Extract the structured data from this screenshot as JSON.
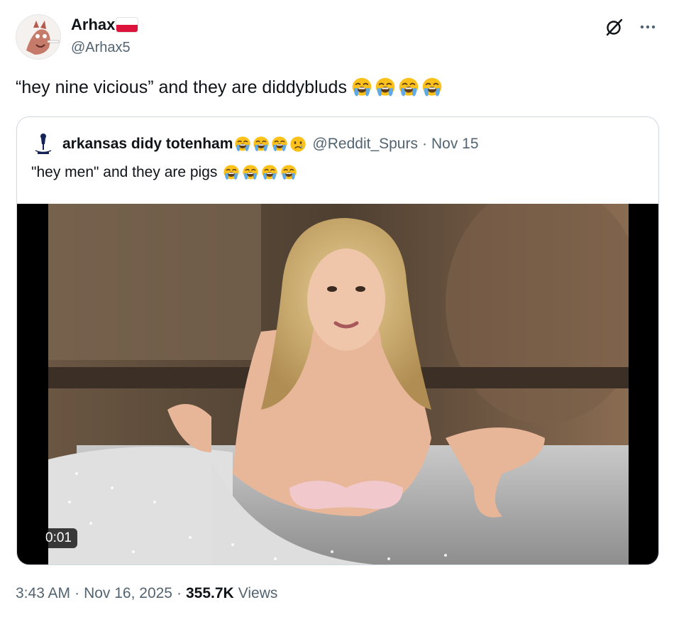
{
  "author": {
    "display_name": "Arhax",
    "handle": "@Arhax5",
    "flag_icon": "poland-flag-icon",
    "flag_colors": [
      "#ffffff",
      "#dc143c"
    ]
  },
  "tweet": {
    "text": "“hey nine vicious” and they are diddybluds",
    "emojis": [
      "loudly-crying-face",
      "loudly-crying-face",
      "loudly-crying-face",
      "loudly-crying-face"
    ]
  },
  "header_icons": [
    "grok-icon",
    "more-options-icon"
  ],
  "quoted": {
    "display_name": "arkansas didy totenham",
    "name_emojis": [
      "loudly-crying-face",
      "loudly-crying-face",
      "loudly-crying-face",
      "crying-face"
    ],
    "handle": "@Reddit_Spurs",
    "separator": "·",
    "date": "Nov 15",
    "text": "\"hey men\" and they are pigs",
    "text_emojis": [
      "loudly-crying-face",
      "loudly-crying-face",
      "loudly-crying-face",
      "loudly-crying-face"
    ],
    "video": {
      "timestamp": "0:01"
    }
  },
  "meta": {
    "time": "3:43 AM",
    "sep1": "·",
    "date": "Nov 16, 2025",
    "sep2": "·",
    "views_count": "355.7K",
    "views_label": "Views"
  },
  "colors": {
    "text_primary": "#0f1419",
    "text_secondary": "#536471",
    "border": "#cfd9de",
    "emoji_yellow": "#fcc21b",
    "tear_blue": "#5ea9e6"
  }
}
